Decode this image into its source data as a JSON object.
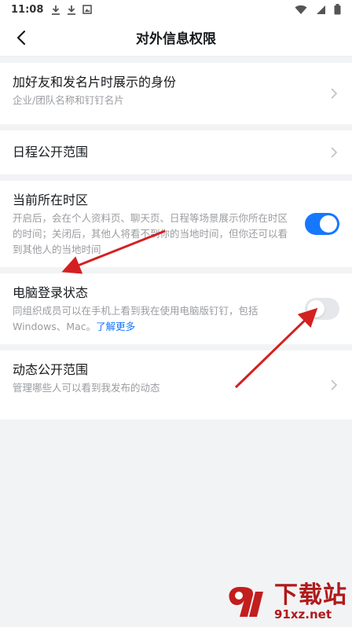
{
  "status_bar": {
    "time": "11:08",
    "icons_left": [
      "download-icon",
      "download-icon",
      "image-icon"
    ],
    "icons_right": [
      "wifi-icon",
      "signal-icon",
      "battery-icon"
    ]
  },
  "nav": {
    "title": "对外信息权限"
  },
  "settings": [
    {
      "title": "加好友和发名片时展示的身份",
      "desc": "企业/团队名称和钉钉名片",
      "control": "chevron"
    },
    {
      "title": "日程公开范围",
      "desc": "",
      "control": "chevron"
    },
    {
      "title": "当前所在时区",
      "desc": "开启后，会在个人资料页、聊天页、日程等场景展示你所在时区的时间；关闭后，其他人将看不到你的当地时间，但你还可以看到其他人的当地时间",
      "control": "toggle",
      "on": true
    },
    {
      "title": "电脑登录状态",
      "desc": "同组织成员可以在手机上看到我在使用电脑版钉钉，包括Windows、Mac。",
      "link": "了解更多",
      "control": "toggle",
      "on": false
    },
    {
      "title": "动态公开范围",
      "desc": "管理哪些人可以看到我发布的动态",
      "control": "chevron"
    }
  ],
  "watermark": {
    "main": "下载站",
    "url": "91xz.net"
  },
  "colors": {
    "accent": "#1677ff",
    "arrow": "#d42020",
    "background": "#f2f3f5"
  }
}
